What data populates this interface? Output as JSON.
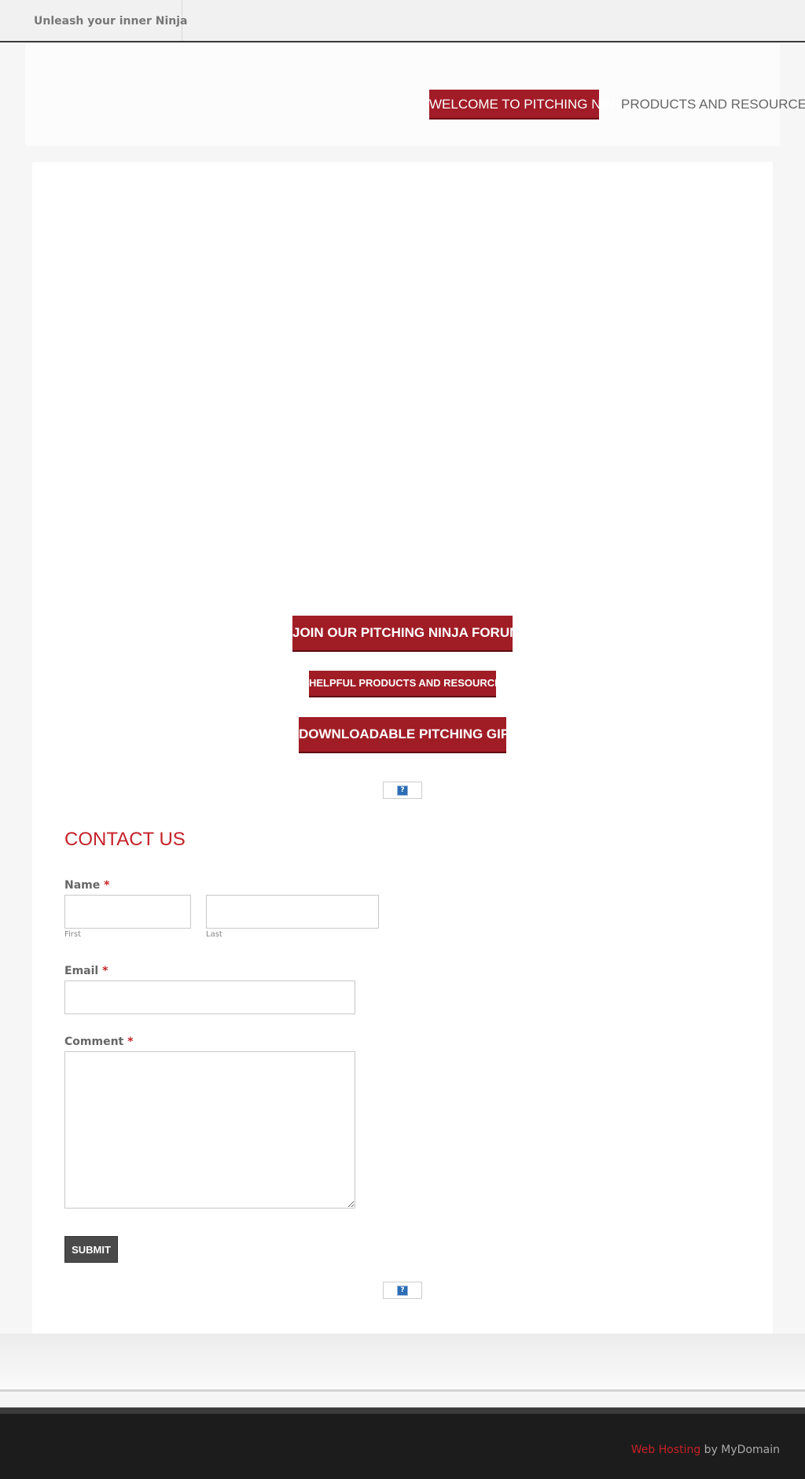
{
  "topbar": {
    "tagline": "Unleash your inner Ninja"
  },
  "nav": {
    "items": [
      {
        "label": "WELCOME TO PITCHING NINJA",
        "active": true
      },
      {
        "label": "PRODUCTS AND RESOURCES",
        "active": false
      }
    ]
  },
  "main": {
    "buttons": {
      "forum": "JOIN OUR PITCHING NINJA FORUM",
      "products": "HELPFUL PRODUCTS AND RESOURCES",
      "gifs": "DOWNLOADABLE PITCHING GIFS"
    },
    "broken_image_glyph": "?",
    "contact": {
      "title": "CONTACT US",
      "required_mark": "*",
      "name_label": "Name",
      "first_sublabel": "First",
      "last_sublabel": "Last",
      "first_value": "",
      "last_value": "",
      "email_label": "Email",
      "email_value": "",
      "comment_label": "Comment",
      "comment_value": "",
      "submit_label": "SUBMIT"
    }
  },
  "footer": {
    "hosting_link": "Web Hosting",
    "by_text": " by MyDomain"
  },
  "colors": {
    "accent_red": "#a01d26",
    "title_red": "#c62128",
    "footer_bg": "#1c1c1c"
  }
}
